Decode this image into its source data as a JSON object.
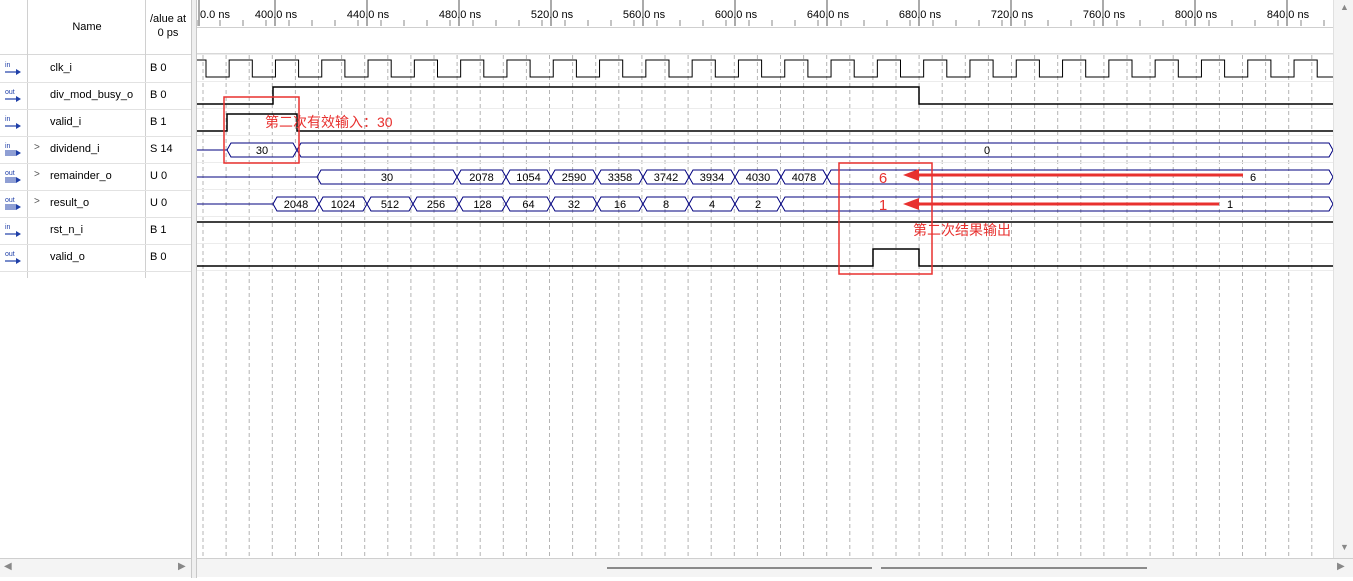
{
  "header": {
    "name_label": "Name",
    "value_label_line1": "/alue at",
    "value_label_line2": "0 ps"
  },
  "signals": [
    {
      "dir": "in",
      "name": "clk_i",
      "value": "B 0",
      "bus": false
    },
    {
      "dir": "out",
      "name": "div_mod_busy_o",
      "value": "B 0",
      "bus": false
    },
    {
      "dir": "in",
      "name": "valid_i",
      "value": "B 1",
      "bus": false
    },
    {
      "dir": "in",
      "name": "dividend_i",
      "value": "S 14",
      "bus": true
    },
    {
      "dir": "out",
      "name": "remainder_o",
      "value": "U 0",
      "bus": true
    },
    {
      "dir": "out",
      "name": "result_o",
      "value": "U 0",
      "bus": true
    },
    {
      "dir": "in",
      "name": "rst_n_i",
      "value": "B 1",
      "bus": false
    },
    {
      "dir": "out",
      "name": "valid_o",
      "value": "B 0",
      "bus": false
    }
  ],
  "time_ruler": {
    "labels": [
      "0.0 ns",
      "400.0 ns",
      "440.0 ns",
      "480.0 ns",
      "520.0 ns",
      "560.0 ns",
      "600.0 ns",
      "640.0 ns",
      "680.0 ns",
      "720.0 ns",
      "760.0 ns",
      "800.0 ns",
      "840.0 ns"
    ]
  },
  "bus_values": {
    "dividend_i": [
      "30",
      "0"
    ],
    "remainder_o": [
      "30",
      "2078",
      "1054",
      "2590",
      "3358",
      "3742",
      "3934",
      "4030",
      "4078",
      "6"
    ],
    "result_o": [
      "2048",
      "1024",
      "512",
      "256",
      "128",
      "64",
      "32",
      "16",
      "8",
      "4",
      "2",
      "1"
    ]
  },
  "annotations": {
    "input_label": "第二次有效输入：30",
    "output_label": "第二次结果输出",
    "remainder_big": "6",
    "result_big": "1",
    "color": "#e8312f"
  },
  "colors": {
    "wave": "#000000",
    "bus_line": "#00007f",
    "grid": "#b4b4b4",
    "ruler_tick": "#555555"
  }
}
